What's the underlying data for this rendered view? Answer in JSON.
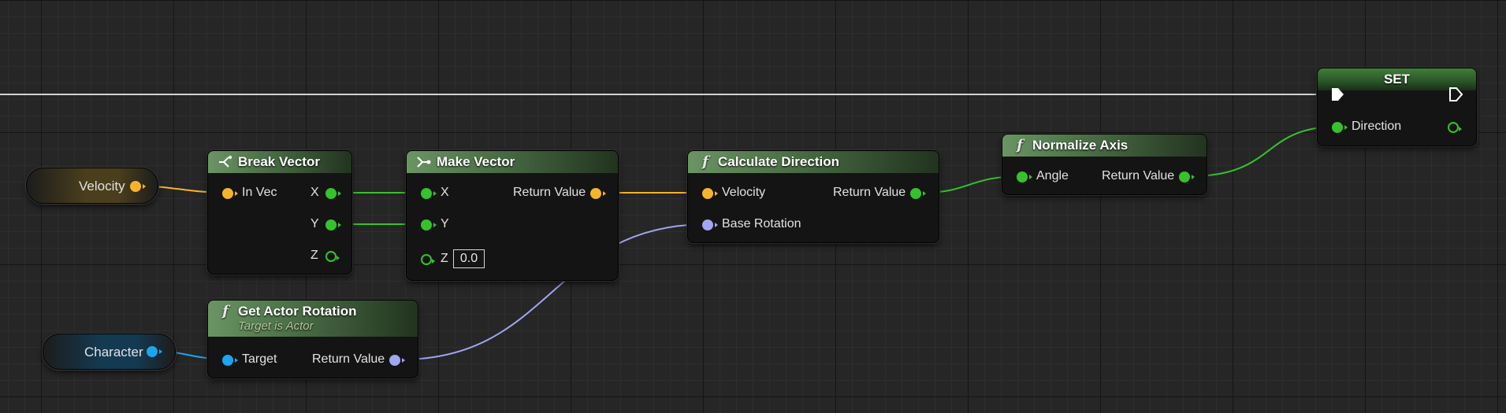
{
  "colors": {
    "float": "#35c22a",
    "vector": "#f7b42b",
    "rotator": "#a0a6f2",
    "object": "#1aa6f0",
    "exec": "#ffffff"
  },
  "variables": {
    "velocity": {
      "label": "Velocity"
    },
    "character": {
      "label": "Character"
    }
  },
  "break_vector": {
    "title": "Break Vector",
    "icon": "break-struct-icon",
    "in_label": "In Vec",
    "out_x": "X",
    "out_y": "Y",
    "out_z": "Z"
  },
  "make_vector": {
    "title": "Make Vector",
    "icon": "make-struct-icon",
    "in_x": "X",
    "in_y": "Y",
    "in_z": "Z",
    "z_value": "0.0",
    "out_label": "Return Value"
  },
  "get_actor_rotation": {
    "title": "Get Actor Rotation",
    "subtitle": "Target is Actor",
    "icon": "function-icon",
    "icon_glyph": "f",
    "in_label": "Target",
    "out_label": "Return Value"
  },
  "calculate_direction": {
    "title": "Calculate Direction",
    "icon": "function-icon",
    "icon_glyph": "f",
    "in_velocity": "Velocity",
    "in_base_rotation": "Base Rotation",
    "out_label": "Return Value"
  },
  "normalize_axis": {
    "title": "Normalize Axis",
    "icon": "function-icon",
    "icon_glyph": "f",
    "in_label": "Angle",
    "out_label": "Return Value"
  },
  "set_node": {
    "title": "SET",
    "in_label": "Direction"
  }
}
